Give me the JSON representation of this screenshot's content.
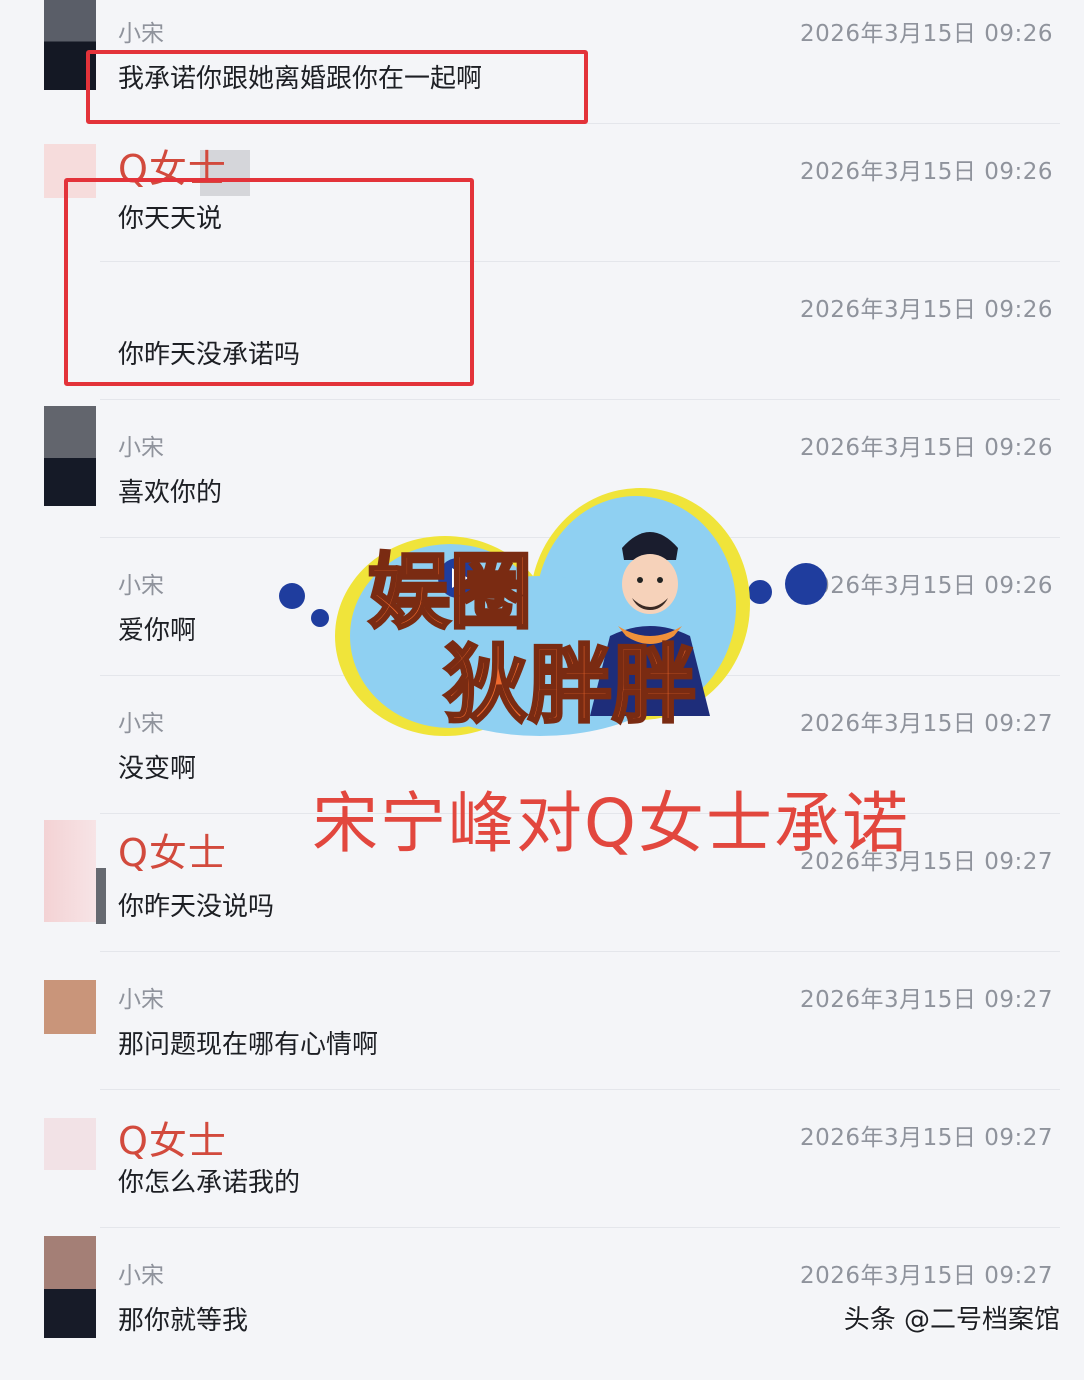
{
  "messages": [
    {
      "sender": "小宋",
      "time": "2026年3月15日 09:26",
      "text": "我承诺你跟她离婚跟你在一起啊"
    },
    {
      "sender": "Q女士",
      "time": "2026年3月15日 09:26",
      "text": "你天天说"
    },
    {
      "sender": "",
      "time": "2026年3月15日 09:26",
      "text": "你昨天没承诺吗"
    },
    {
      "sender": "小宋",
      "time": "2026年3月15日 09:26",
      "text": "喜欢你的"
    },
    {
      "sender": "小宋",
      "time": "2026年3月15日 09:26",
      "text": "爱你啊"
    },
    {
      "sender": "小宋",
      "time": "2026年3月15日 09:27",
      "text": "没变啊"
    },
    {
      "sender": "Q女士",
      "time": "2026年3月15日 09:27",
      "text": "你昨天没说吗"
    },
    {
      "sender": "小宋",
      "time": "2026年3月15日 09:27",
      "text": "那问题现在哪有心情啊"
    },
    {
      "sender": "Q女士",
      "time": "2026年3月15日 09:27",
      "text": "你怎么承诺我的"
    },
    {
      "sender": "小宋",
      "time": "2026年3月15日 09:27",
      "text": "那你就等我"
    }
  ],
  "overlay": {
    "logo_line1": "娱圈",
    "logo_line2": "狄胖胖",
    "title": "宋宁峰对Q女士承诺"
  },
  "watermark": "头条 @二号档案馆",
  "colors": {
    "highlight_box": "#e3333a",
    "sender_q": "#d24a3d",
    "title": "#e2473e"
  }
}
